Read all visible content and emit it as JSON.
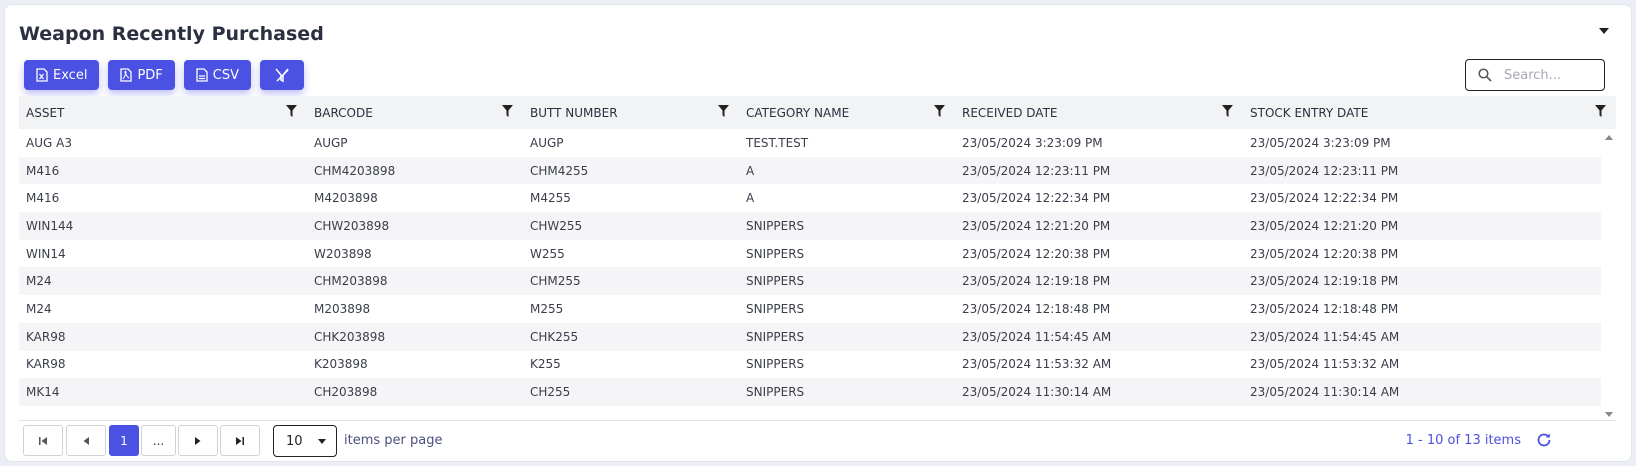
{
  "title": "Weapon Recently Purchased",
  "toolbar": {
    "excel_label": "Excel",
    "pdf_label": "PDF",
    "csv_label": "CSV"
  },
  "search": {
    "placeholder": "Search..."
  },
  "columns": [
    "ASSET",
    "BARCODE",
    "BUTT NUMBER",
    "CATEGORY NAME",
    "RECEIVED DATE",
    "STOCK ENTRY DATE"
  ],
  "rows": [
    [
      "AUG A3",
      "AUGP",
      "AUGP",
      "TEST.TEST",
      "23/05/2024 3:23:09 PM",
      "23/05/2024 3:23:09 PM"
    ],
    [
      "M416",
      "CHM4203898",
      "CHM4255",
      "A",
      "23/05/2024 12:23:11 PM",
      "23/05/2024 12:23:11 PM"
    ],
    [
      "M416",
      "M4203898",
      "M4255",
      "A",
      "23/05/2024 12:22:34 PM",
      "23/05/2024 12:22:34 PM"
    ],
    [
      "WIN144",
      "CHW203898",
      "CHW255",
      "SNIPPERS",
      "23/05/2024 12:21:20 PM",
      "23/05/2024 12:21:20 PM"
    ],
    [
      "WIN14",
      "W203898",
      "W255",
      "SNIPPERS",
      "23/05/2024 12:20:38 PM",
      "23/05/2024 12:20:38 PM"
    ],
    [
      "M24",
      "CHM203898",
      "CHM255",
      "SNIPPERS",
      "23/05/2024 12:19:18 PM",
      "23/05/2024 12:19:18 PM"
    ],
    [
      "M24",
      "M203898",
      "M255",
      "SNIPPERS",
      "23/05/2024 12:18:48 PM",
      "23/05/2024 12:18:48 PM"
    ],
    [
      "KAR98",
      "CHK203898",
      "CHK255",
      "SNIPPERS",
      "23/05/2024 11:54:45 AM",
      "23/05/2024 11:54:45 AM"
    ],
    [
      "KAR98",
      "K203898",
      "K255",
      "SNIPPERS",
      "23/05/2024 11:53:32 AM",
      "23/05/2024 11:53:32 AM"
    ],
    [
      "MK14",
      "CH203898",
      "CH255",
      "SNIPPERS",
      "23/05/2024 11:30:14 AM",
      "23/05/2024 11:30:14 AM"
    ]
  ],
  "pager": {
    "current_page": "1",
    "ellipsis": "...",
    "page_size": "10",
    "items_per_page_label": "items per page",
    "info": "1 - 10 of 13 items"
  },
  "colors": {
    "accent": "#4a51e3",
    "header_bg": "#f2f3f5",
    "alt_row_bg": "#f5f5f7"
  },
  "icons": [
    "excel-icon",
    "pdf-icon",
    "csv-icon",
    "clear-filter-icon",
    "search-icon",
    "filter-icon",
    "first-page-icon",
    "prev-page-icon",
    "next-page-icon",
    "last-page-icon",
    "refresh-icon",
    "collapse-icon"
  ]
}
